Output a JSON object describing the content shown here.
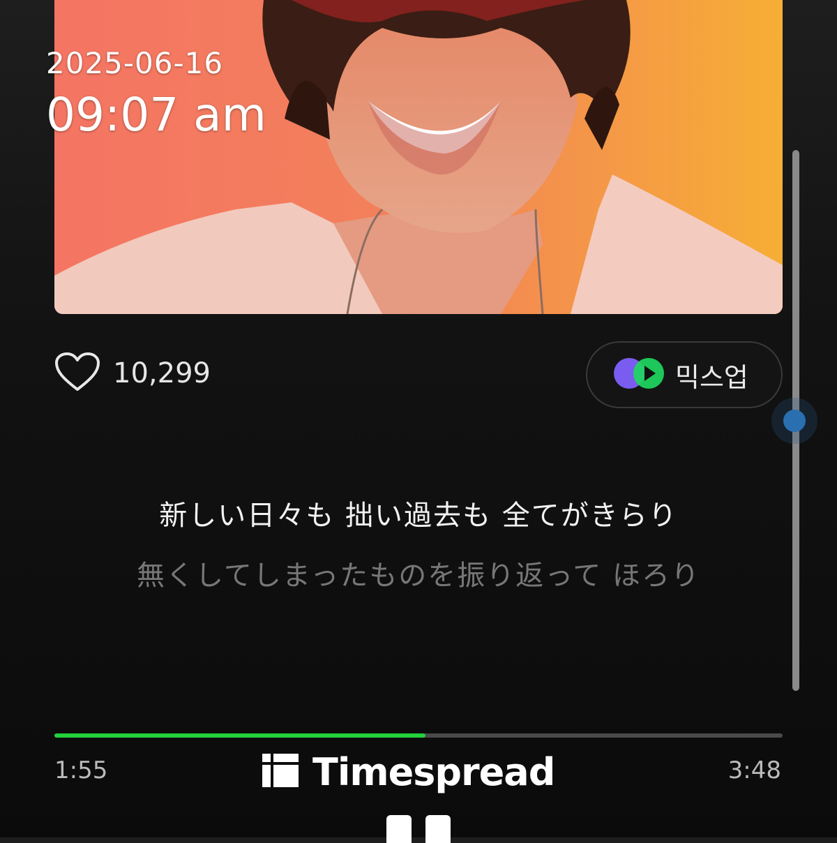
{
  "overlay": {
    "date": "2025-06-16",
    "time": "09:07 am"
  },
  "player": {
    "like_count": "10,299",
    "mixup_label": "믹스업",
    "lyrics": {
      "current": "新しい日々も 拙い過去も 全てがきらり",
      "next": "無くしてしまったものを振り返って ほろり"
    },
    "elapsed": "1:55",
    "total": "3:48",
    "progress_fraction": 0.51
  },
  "watermark": {
    "text": "Timespread"
  },
  "icons": [
    "heart-icon",
    "mixup-icon",
    "timespread-logo-icon",
    "pause-icon"
  ],
  "colors": {
    "progress": "#22d13b",
    "scroll_thumb": "#2a6fb0",
    "accent_purple": "#7b5cf0",
    "accent_green": "#1ed760"
  }
}
